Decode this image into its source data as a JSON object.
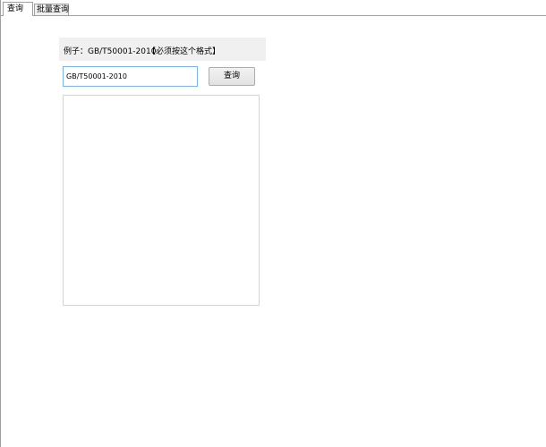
{
  "tabs": [
    {
      "label": "查询",
      "active": true
    },
    {
      "label": "批量查询",
      "active": false
    }
  ],
  "hint": {
    "example": "例子：GB/T50001-2010",
    "note": "【必须按这个格式】"
  },
  "search": {
    "value": "GB/T50001-2010",
    "button_label": "查询"
  },
  "results": {
    "value": ""
  },
  "colors": {
    "input_focus_border": "#7eb4ea",
    "panel_bg": "#f0f0f0"
  }
}
